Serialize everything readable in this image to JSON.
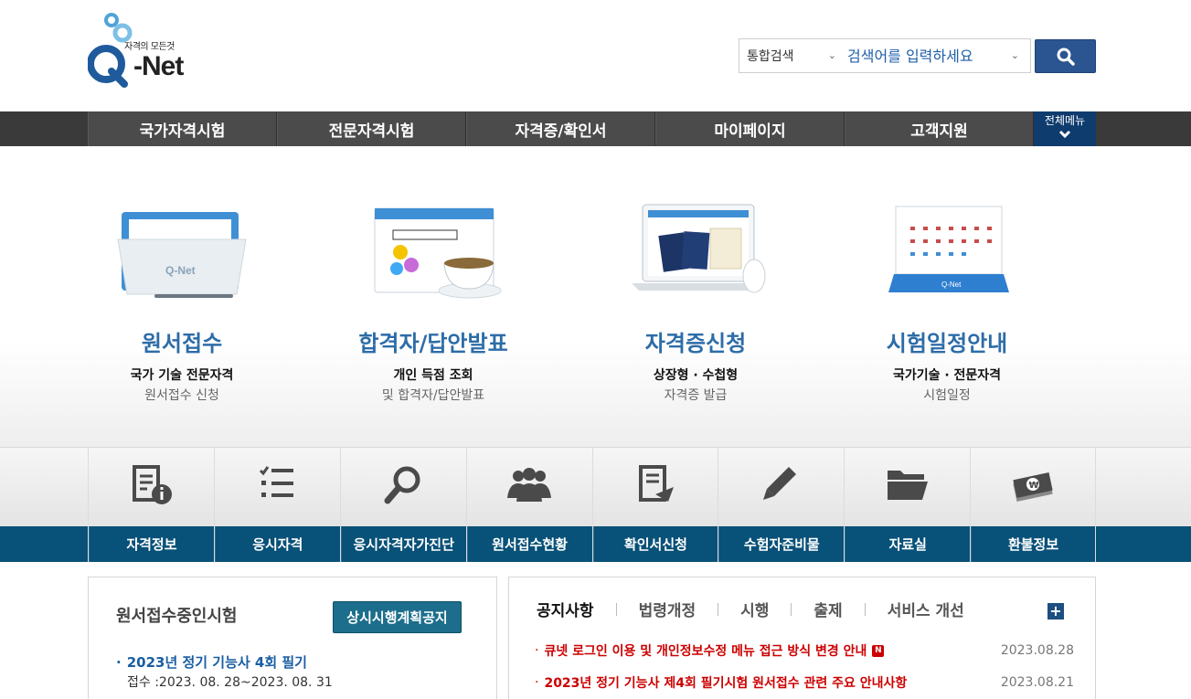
{
  "header": {
    "logo_tagline": "자격의 모든것",
    "logo_name": "-Net",
    "search_type": "통합검색",
    "search_placeholder": "검색어를 입력하세요"
  },
  "gnb": {
    "items": [
      "국가자격시험",
      "전문자격시험",
      "자격증/확인서",
      "마이페이지",
      "고객지원"
    ],
    "all_menu_label": "전체메뉴"
  },
  "hero": {
    "cards": [
      {
        "title": "원서접수",
        "line1": "국가 기술 전문자격",
        "line2": "원서접수 신청"
      },
      {
        "title": "합격자/답안발표",
        "line1": "개인 득점 조회",
        "line2": "및 합격자/답안발표"
      },
      {
        "title": "자격증신청",
        "line1": "상장형 · 수첩형",
        "line2": "자격증 발급"
      },
      {
        "title": "시험일정안내",
        "line1": "국가기술 · 전문자격",
        "line2": "시험일정"
      }
    ]
  },
  "quick": {
    "items": [
      "자격정보",
      "응시자격",
      "응시자격자가진단",
      "원서접수현황",
      "확인서신청",
      "수험자준비물",
      "자료실",
      "환불정보"
    ]
  },
  "exam_box": {
    "title": "원서접수중인시험",
    "button_label": "상시시행계획공지",
    "item_title": "2023년 정기 기능사 4회 필기",
    "item_period": "접수 :2023. 08. 28~2023. 08. 31"
  },
  "notice_box": {
    "tabs": [
      "공지사항",
      "법령개정",
      "시행",
      "출제",
      "서비스 개선"
    ],
    "more_label": "+",
    "notices": [
      {
        "text": "큐넷 로그인 이용 및 개인정보수정 메뉴 접근 방식 변경 안내",
        "badge": "N",
        "date": "2023.08.28"
      },
      {
        "text": "2023년 정기 기능사 제4회 필기시험 원서접수 관련 주요 안내사항",
        "badge": "",
        "date": "2023.08.21"
      }
    ]
  },
  "colors": {
    "brand_blue": "#2d6ca8",
    "nav_dark": "#3a3a3a",
    "quick_bar": "#085178",
    "notice_red": "#cc0000"
  }
}
